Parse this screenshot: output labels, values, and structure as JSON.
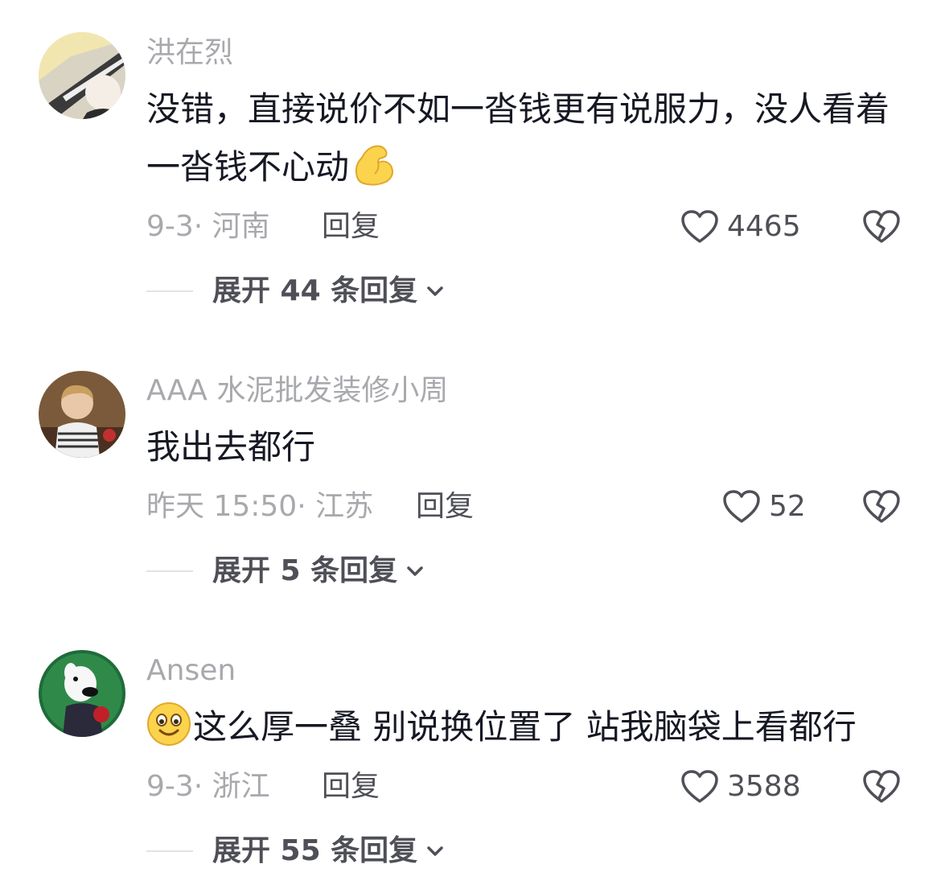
{
  "comments": [
    {
      "username": "洪在烈",
      "content": "没错，直接说价不如一沓钱更有说服力，没人看着一沓钱不心动",
      "trailing_emoji": "flexed-biceps",
      "date_location": "9-3· 河南",
      "reply_label": "回复",
      "likes": "4465",
      "expand_label": "展开 44 条回复"
    },
    {
      "username": "AAA 水泥批发装修小周",
      "content": "我出去都行",
      "date_location": "昨天 15:50· 江苏",
      "reply_label": "回复",
      "likes": "52",
      "expand_label": "展开 5 条回复"
    },
    {
      "username": "Ansen",
      "leading_emoji": "smiling-face",
      "content": "这么厚一叠 别说换位置了 站我脑袋上看都行",
      "date_location": "9-3· 浙江",
      "reply_label": "回复",
      "likes": "3588",
      "expand_label": "展开 55 条回复"
    }
  ],
  "icons": {
    "like": "heart-outline-icon",
    "dislike": "broken-heart-icon",
    "expand": "chevron-down-icon"
  },
  "colors": {
    "text_primary": "#161823",
    "text_secondary": "#a8a9ad",
    "action_text": "#4f5057",
    "divider": "#e3e3e5"
  }
}
